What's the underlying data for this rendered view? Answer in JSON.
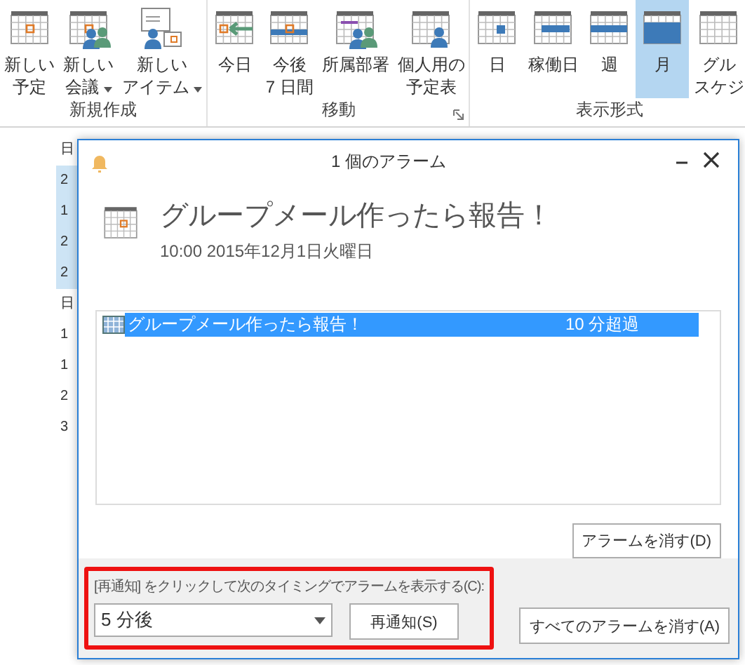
{
  "ribbon": {
    "groups": [
      {
        "label": "新規作成",
        "launcher": false,
        "buttons": [
          {
            "kind": "appointment",
            "lines": [
              "新しい",
              "予定"
            ],
            "dropdown": false,
            "selected": false
          },
          {
            "kind": "meeting",
            "lines": [
              "新しい",
              "会議"
            ],
            "dropdown": true,
            "selected": false
          },
          {
            "kind": "item",
            "lines": [
              "新しい",
              "アイテム"
            ],
            "dropdown": true,
            "selected": false
          }
        ]
      },
      {
        "label": "移動",
        "launcher": true,
        "buttons": [
          {
            "kind": "today",
            "lines": [
              "今日"
            ],
            "dropdown": false,
            "selected": false
          },
          {
            "kind": "next7",
            "lines": [
              "今後",
              "7 日間"
            ],
            "dropdown": false,
            "selected": false
          },
          {
            "kind": "group",
            "lines": [
              "所属部署"
            ],
            "dropdown": false,
            "selected": false
          },
          {
            "kind": "person",
            "lines": [
              "個人用の",
              "予定表"
            ],
            "dropdown": false,
            "selected": false
          }
        ]
      },
      {
        "label": "表示形式",
        "launcher": false,
        "buttons": [
          {
            "kind": "day",
            "lines": [
              "日"
            ],
            "dropdown": false,
            "selected": false
          },
          {
            "kind": "workweek",
            "lines": [
              "稼働日"
            ],
            "dropdown": false,
            "selected": false
          },
          {
            "kind": "week",
            "lines": [
              "週"
            ],
            "dropdown": false,
            "selected": false
          },
          {
            "kind": "month",
            "lines": [
              "月"
            ],
            "dropdown": false,
            "selected": true
          },
          {
            "kind": "schedule",
            "lines": [
              "グル",
              "スケジ"
            ],
            "dropdown": false,
            "selected": false
          }
        ]
      }
    ]
  },
  "background_pane": {
    "labels": [
      {
        "text": "日",
        "band": false
      },
      {
        "text": "2",
        "band": true
      },
      {
        "text": "1",
        "band": true
      },
      {
        "text": "2",
        "band": true
      },
      {
        "text": "2",
        "band": true
      },
      {
        "text": "日",
        "band": false
      },
      {
        "text": "1",
        "band": false
      },
      {
        "text": "1",
        "band": false
      },
      {
        "text": "2",
        "band": false
      },
      {
        "text": "3",
        "band": false
      }
    ]
  },
  "dialog": {
    "title": "1 個のアラーム",
    "subject": "グループメール作ったら報告！",
    "time": "10:00 2015年12月1日火曜日",
    "reminders": [
      {
        "subject": "グループメール作ったら報告！",
        "due": "10 分超過",
        "selected": true
      }
    ],
    "dismiss_button": "アラームを消す(D)",
    "snooze_label": "[再通知] をクリックして次のタイミングでアラームを表示する(C):",
    "snooze_select": "5 分後",
    "snooze_button": "再通知(S)",
    "dismiss_all_button": "すべてのアラームを消す(A)",
    "highlighted": true
  }
}
